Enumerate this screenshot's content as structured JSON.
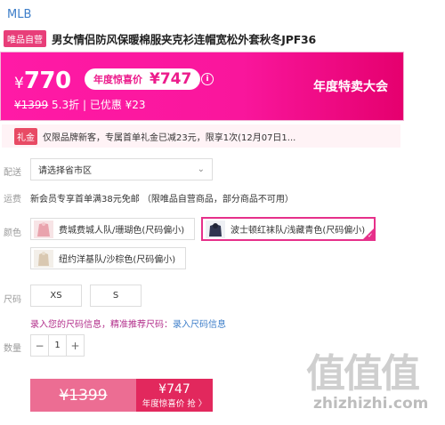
{
  "brand": "MLB",
  "product": {
    "self_operated_tag": "唯品自营",
    "title": "男女情侣防风保暖棉服夹克衫连帽宽松外套秋冬JPF36"
  },
  "price_banner": {
    "currency": "¥",
    "current_price": "770",
    "promo_label": "年度惊喜价",
    "promo_price": "¥747",
    "original_price": "¥1399",
    "discount": "5.3折",
    "separator": "|",
    "saved": "已优惠 ¥23",
    "event_name": "年度特卖大会",
    "info_icon": "ⓘ"
  },
  "coupon": {
    "tag": "礼金",
    "text": "仅限品牌新客，专属首单礼金已减23元，限享1次(12月07日1..."
  },
  "delivery": {
    "label": "配送",
    "select_value": "请选择省市区",
    "chevron": "⌄"
  },
  "shipping": {
    "label": "运费",
    "text": "新会员专享首单满38元免邮 （限唯品自营商品，部分商品不可用）"
  },
  "colors": {
    "label": "颜色",
    "options": [
      {
        "label": "费城费城人队/珊瑚色(尺码偏小)",
        "selected": false
      },
      {
        "label": "波士顿红袜队/浅藏青色(尺码偏小)",
        "selected": true
      },
      {
        "label": "纽约洋基队/沙棕色(尺码偏小)",
        "selected": false
      }
    ]
  },
  "sizes": {
    "label": "尺码",
    "options": [
      "XS",
      "S"
    ]
  },
  "size_hint": {
    "text": "录入您的尺码信息，精准推荐尺码：",
    "link": "录入尺码信息"
  },
  "quantity": {
    "label": "数量",
    "minus": "−",
    "value": "1",
    "plus": "+"
  },
  "buy": {
    "original_price": "¥1399",
    "promo_price": "¥747",
    "promo_label": "年度惊喜价 抢 〉"
  },
  "watermark": {
    "glyphs": "值值值",
    "site": "zhizhizhi.com"
  },
  "accent_colors": {
    "brand_pink": "#f9169c",
    "selected_border": "#e6308a",
    "buy_dark": "#e2285d",
    "buy_light": "#ec6d93",
    "link_blue": "#3d7ec9"
  }
}
